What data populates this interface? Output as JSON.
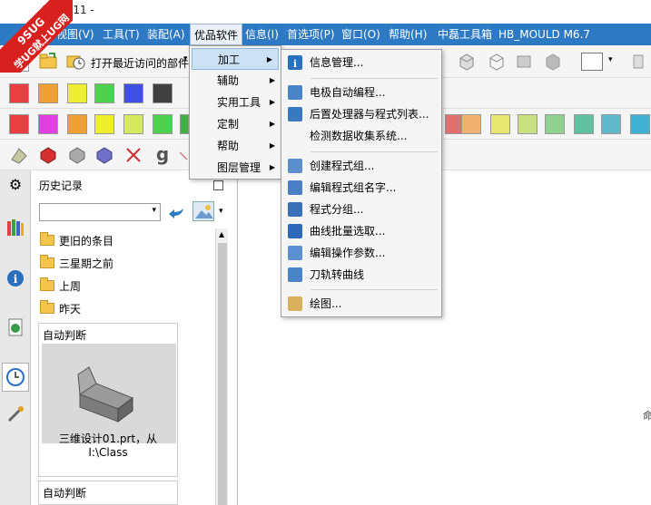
{
  "window": {
    "title": "1.0.1.11 -"
  },
  "logo": {
    "line1": "9SUG",
    "line2": "学UG就上UG网"
  },
  "menubar": {
    "items": [
      {
        "label": "视图(V)"
      },
      {
        "label": "工具(T)"
      },
      {
        "label": "装配(A)"
      },
      {
        "label": "优品软件"
      },
      {
        "label": "信息(I)"
      },
      {
        "label": "首选项(P)"
      },
      {
        "label": "窗口(O)"
      },
      {
        "label": "帮助(H)"
      },
      {
        "label": "中磊工具箱"
      },
      {
        "label": "HB_MOULD M6.7"
      }
    ]
  },
  "toolbar": {
    "recent_label": "打开最近访问的部件"
  },
  "colors": {
    "row1": [
      "#e84040",
      "#f0a030",
      "#eeee30",
      "#50d050",
      "#4050e0",
      "#404040"
    ],
    "row2": [
      "#e84040",
      "#e040e0",
      "#f0a030",
      "#eeee30",
      "#d4e860",
      "#50d050",
      "#40b040"
    ],
    "row2_right": [
      "#e07070",
      "#f0b070",
      "#e8e870",
      "#c8e080",
      "#90d090",
      "#60c0a0",
      "#60b8c8",
      "#40b0d0"
    ]
  },
  "menu_dropdown": {
    "items": [
      {
        "label": "加工"
      },
      {
        "label": "辅助"
      },
      {
        "label": "实用工具"
      },
      {
        "label": "定制"
      },
      {
        "label": "帮助"
      },
      {
        "label": "图层管理"
      }
    ]
  },
  "submenu": {
    "items": [
      {
        "label": "信息管理...",
        "icon": "info-icon"
      },
      {
        "label": "电极自动编程...",
        "icon": "electrode-icon"
      },
      {
        "label": "后置处理器与程式列表...",
        "icon": "post-processor-icon"
      },
      {
        "label": "检测数据收集系统...",
        "icon": ""
      },
      {
        "label": "创建程式组...",
        "icon": "create-group-icon"
      },
      {
        "label": "编辑程式组名字...",
        "icon": "edit-group-name-icon"
      },
      {
        "label": "程式分组...",
        "icon": "program-group-icon"
      },
      {
        "label": "曲线批量选取...",
        "icon": "curve-select-icon"
      },
      {
        "label": "编辑操作参数...",
        "icon": "edit-params-icon"
      },
      {
        "label": "刀轨转曲线",
        "icon": "toolpath-curve-icon"
      },
      {
        "label": "绘图...",
        "icon": "drawing-icon"
      }
    ]
  },
  "history": {
    "title": "历史记录",
    "folders": [
      {
        "label": "更旧的条目"
      },
      {
        "label": "三星期之前"
      },
      {
        "label": "上周"
      },
      {
        "label": "昨天"
      }
    ],
    "card1": {
      "header": "自动判断",
      "caption1": "三维设计01.prt，从",
      "caption2": "I:\\Class"
    },
    "card2": {
      "header": "自动判断"
    }
  },
  "graphics": {
    "edge_glyph": "命"
  }
}
